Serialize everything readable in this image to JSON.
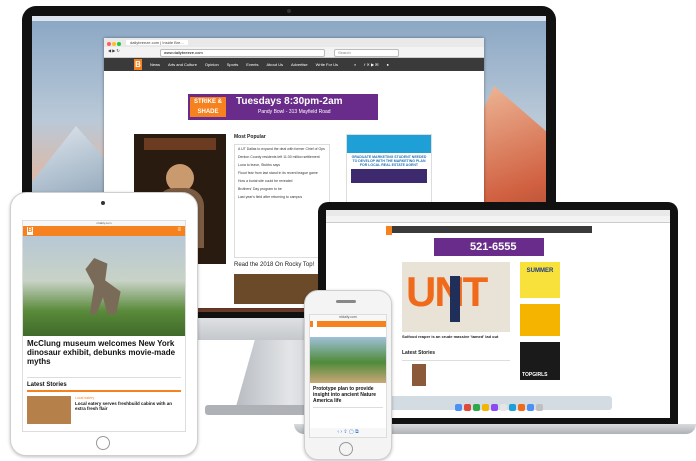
{
  "imac_browser": {
    "tab_title": "dailybreeze.com | Inside Bre...",
    "url": "www.dailybreeze.com",
    "search_placeholder": "Search",
    "nav": [
      "News",
      "Arts and Culture",
      "Opinion",
      "Sports",
      "Events",
      "About Us",
      "Advertise",
      "Write For Us"
    ],
    "banner_title": "STRIKE & SHADE",
    "banner_time": "Tuesdays 8:30pm-2am",
    "banner_place": "Pandy Bowl - 313 Mayfield Road",
    "most_popular": "Most Popular",
    "popular_items": [
      "A UT Dallas to expand the deal with former Chief of Ops",
      "Denton County residents left 11:30 million settlement",
      "Luna to leave, Stubbs says",
      "Flood fear from last stand in its recent league game",
      "How a burial site could be revealed",
      "Brothers' Day program to be",
      "Last year's field after returning to campus"
    ],
    "ad_text": "GRADUATE MARKETING STUDENT NEEDED TO DEVELOP WITH THE MARKETING PLAN FOR LOCAL REAL ESTATE AGENT",
    "read_link": "Read the 2018 On Rocky Top!"
  },
  "ipad": {
    "url": "ntdaily.com",
    "headline": "McClung museum welcomes New York dinosaur exhibit, debunks movie-made myths",
    "latest_title": "Latest Stories",
    "story_kicker": "Local eatery",
    "story_title": "Local eatery serves freshbuild cabins with an extra fresh flair"
  },
  "macbook": {
    "phone": "521-6555",
    "caption": "Solfood reaper is an crude massive 'tamed' lad out",
    "latest_title": "Latest Stories",
    "ad_summer": "SUMMER",
    "ad_topgirls": "TOPGIRLS"
  },
  "iphone": {
    "url": "ntdaily.com",
    "headline": "Prototype plan to provide insight into ancient Nature America life"
  },
  "colors": {
    "brand_orange": "#f5821f",
    "banner_purple": "#6a2c8a",
    "ad_blue": "#1e9fd6"
  }
}
